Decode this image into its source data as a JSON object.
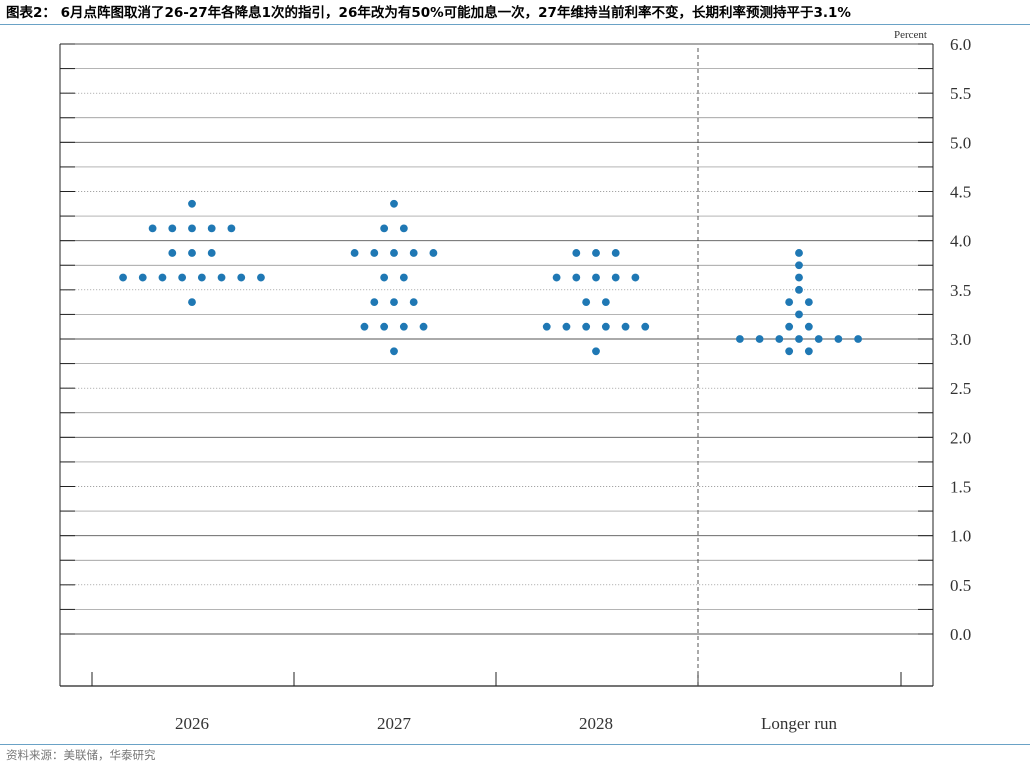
{
  "title": "图表2：  6月点阵图取消了26-27年各降息1次的指引，26年改为有50%可能加息一次，27年维持当前利率不变，长期利率预测持平于3.1%",
  "source": "资料来源：美联储，华泰研究",
  "chart_data": {
    "type": "scatter",
    "unit_label": "Percent",
    "categories": [
      "2026",
      "2027",
      "2028",
      "Longer run"
    ],
    "ylim": [
      0,
      6
    ],
    "y_ticks": [
      "0.0",
      "0.5",
      "1.0",
      "1.5",
      "2.0",
      "2.5",
      "3.0",
      "3.5",
      "4.0",
      "4.5",
      "5.0",
      "5.5",
      "6.0"
    ],
    "grid": true,
    "dot_color": "#1f78b4",
    "series": [
      {
        "category": "2026",
        "dots": [
          {
            "y": 4.375,
            "count": 1
          },
          {
            "y": 4.125,
            "count": 5
          },
          {
            "y": 3.875,
            "count": 3
          },
          {
            "y": 3.625,
            "count": 8
          },
          {
            "y": 3.375,
            "count": 1
          }
        ]
      },
      {
        "category": "2027",
        "dots": [
          {
            "y": 4.375,
            "count": 1
          },
          {
            "y": 4.125,
            "count": 2
          },
          {
            "y": 3.875,
            "count": 5
          },
          {
            "y": 3.625,
            "count": 2
          },
          {
            "y": 3.375,
            "count": 3
          },
          {
            "y": 3.125,
            "count": 4
          },
          {
            "y": 2.875,
            "count": 1
          }
        ]
      },
      {
        "category": "2028",
        "dots": [
          {
            "y": 3.875,
            "count": 3
          },
          {
            "y": 3.625,
            "count": 5
          },
          {
            "y": 3.375,
            "count": 2
          },
          {
            "y": 3.125,
            "count": 6
          },
          {
            "y": 2.875,
            "count": 1
          }
        ]
      },
      {
        "category": "Longer run",
        "dots": [
          {
            "y": 3.875,
            "count": 1
          },
          {
            "y": 3.75,
            "count": 1
          },
          {
            "y": 3.625,
            "count": 1
          },
          {
            "y": 3.5,
            "count": 1
          },
          {
            "y": 3.375,
            "count": 2
          },
          {
            "y": 3.25,
            "count": 1
          },
          {
            "y": 3.125,
            "count": 2
          },
          {
            "y": 3.0,
            "count": 7
          },
          {
            "y": 2.875,
            "count": 2
          }
        ]
      }
    ]
  }
}
